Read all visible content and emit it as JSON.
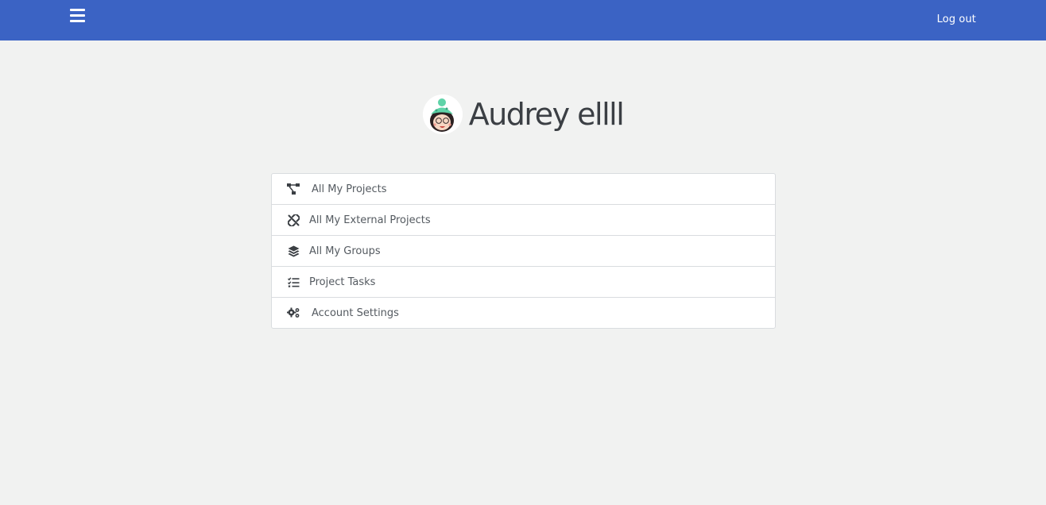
{
  "header": {
    "menu_icon": "hamburger-menu-icon",
    "logout_label": "Log out",
    "brand_color": "#3b63c4"
  },
  "profile": {
    "name": "Audrey ellll",
    "avatar_icon": "user-avatar"
  },
  "menu": {
    "items": [
      {
        "label": "All My Projects",
        "icon": "project-diagram-icon"
      },
      {
        "label": "All My External Projects",
        "icon": "unlink-icon"
      },
      {
        "label": "All My Groups",
        "icon": "layers-icon"
      },
      {
        "label": "Project Tasks",
        "icon": "task-list-icon"
      },
      {
        "label": "Account Settings",
        "icon": "cogs-icon"
      }
    ]
  }
}
